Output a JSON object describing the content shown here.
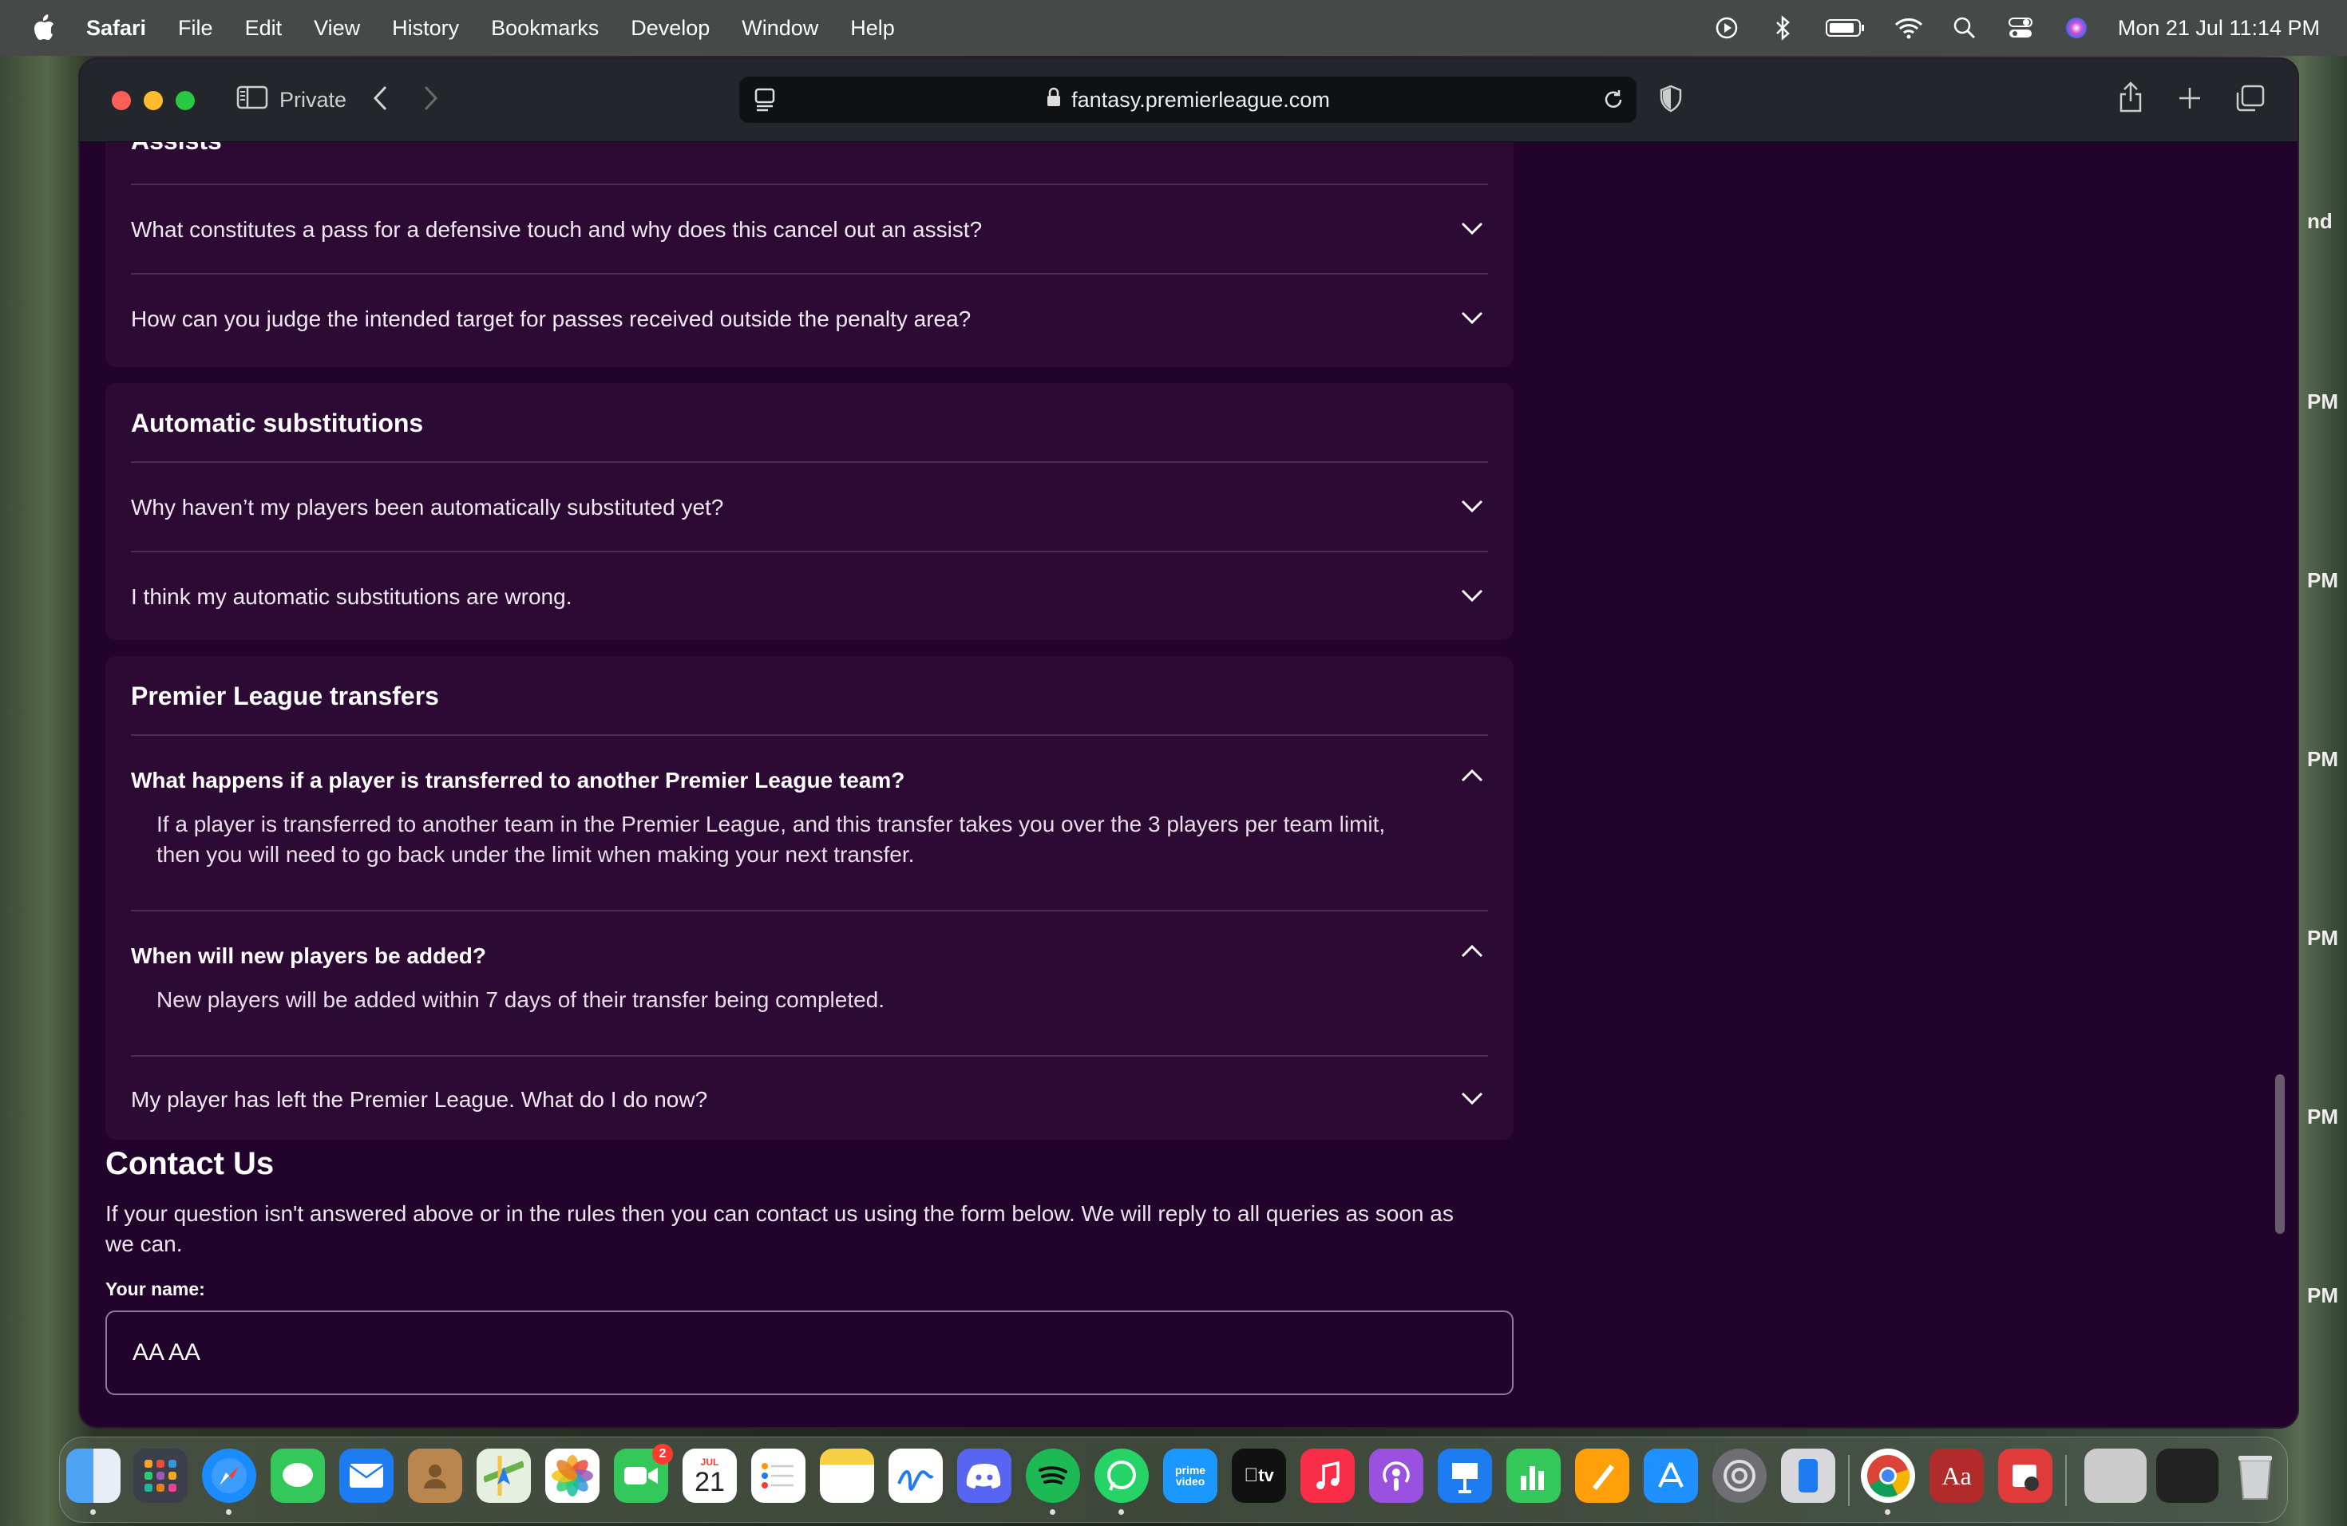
{
  "menubar": {
    "app": "Safari",
    "items": [
      "File",
      "Edit",
      "View",
      "History",
      "Bookmarks",
      "Develop",
      "Window",
      "Help"
    ],
    "clock": "Mon 21 Jul  11:14 PM"
  },
  "browser": {
    "private_label": "Private",
    "url": "fantasy.premierleague.com"
  },
  "faq": {
    "assists": {
      "title": "Assists",
      "q1": "What constitutes a pass for a defensive touch and why does this cancel out an assist?",
      "q2": "How can you judge the intended target for passes received outside the penalty area?"
    },
    "autosubs": {
      "title": "Automatic substitutions",
      "q1": "Why haven’t my players been automatically substituted yet?",
      "q2": "I think my automatic substitutions are wrong."
    },
    "transfers": {
      "title": "Premier League transfers",
      "q1": "What happens if a player is transferred to another Premier League team?",
      "a1_line1": "If a player is transferred to another team in the Premier League, and this transfer takes you over the 3 players per team limit,",
      "a1_line2": "then you will need to go back under the limit when making your next transfer.",
      "q2": "When will new players be added?",
      "a2": "New players will be added within 7 days of their transfer being completed.",
      "q3": "My player has left the Premier League. What do I do now?"
    }
  },
  "contact": {
    "title": "Contact Us",
    "text_line1": "If your question isn't answered above or in the rules then you can contact us using the form below. We will reply to all queries as soon as",
    "text_line2": "we can.",
    "name_label": "Your name:",
    "name_value": "AA AA"
  },
  "edge_labels": [
    "nd",
    "PM",
    "PM",
    "PM",
    "PM",
    "PM",
    "PM"
  ],
  "dock": {
    "messages_badge": "2",
    "calendar_month": "JUL",
    "calendar_day": "21",
    "prime_label": "prime video",
    "tv_label": "tv",
    "dictionary_label": "Aa"
  },
  "colors": {
    "page_bg": "#22032b",
    "card_bg": "#2d0a34",
    "divider": "#4a2e52"
  }
}
